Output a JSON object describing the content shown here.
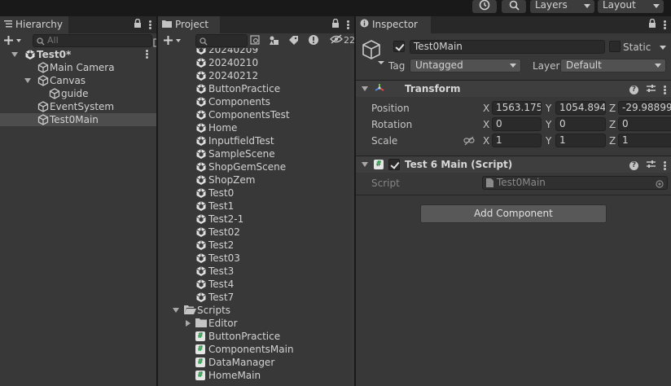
{
  "toolbar": {
    "history_icon": "history-icon",
    "search_icon": "search-icon",
    "layers_label": "Layers",
    "layout_label": "Layout"
  },
  "hierarchy": {
    "tab_label": "Hierarchy",
    "search_placeholder": "All",
    "items": [
      {
        "label": "Test0*",
        "level": 0,
        "expanded": true,
        "bold": true,
        "icon": "unity-scene-icon"
      },
      {
        "label": "Main Camera",
        "level": 1,
        "icon": "gameobject-cube-icon"
      },
      {
        "label": "Canvas",
        "level": 1,
        "expanded": true,
        "icon": "gameobject-cube-icon"
      },
      {
        "label": "guide",
        "level": 2,
        "icon": "gameobject-cube-icon"
      },
      {
        "label": "EventSystem",
        "level": 1,
        "icon": "gameobject-cube-icon"
      },
      {
        "label": "Test0Main",
        "level": 1,
        "selected": true,
        "icon": "gameobject-cube-icon"
      }
    ]
  },
  "project": {
    "tab_label": "Project",
    "hidden_count": "22",
    "items": [
      {
        "label": "20240209",
        "icon": "unity-scene-icon"
      },
      {
        "label": "20240210",
        "icon": "unity-scene-icon"
      },
      {
        "label": "20240212",
        "icon": "unity-scene-icon"
      },
      {
        "label": "ButtonPractice",
        "icon": "unity-scene-icon"
      },
      {
        "label": "Components",
        "icon": "unity-scene-icon"
      },
      {
        "label": "ComponentsTest",
        "icon": "unity-scene-icon"
      },
      {
        "label": "Home",
        "icon": "unity-scene-icon"
      },
      {
        "label": "InputfieldTest",
        "icon": "unity-scene-icon"
      },
      {
        "label": "SampleScene",
        "icon": "unity-scene-icon"
      },
      {
        "label": "ShopGemScene",
        "icon": "unity-scene-icon"
      },
      {
        "label": "ShopZem",
        "icon": "unity-scene-icon"
      },
      {
        "label": "Test0",
        "icon": "unity-scene-icon"
      },
      {
        "label": "Test1",
        "icon": "unity-scene-icon"
      },
      {
        "label": "Test2-1",
        "icon": "unity-scene-icon"
      },
      {
        "label": "Test02",
        "icon": "unity-scene-icon"
      },
      {
        "label": "Test2",
        "icon": "unity-scene-icon"
      },
      {
        "label": "Test03",
        "icon": "unity-scene-icon"
      },
      {
        "label": "Test3",
        "icon": "unity-scene-icon"
      },
      {
        "label": "Test4",
        "icon": "unity-scene-icon"
      },
      {
        "label": "Test7",
        "icon": "unity-scene-icon"
      },
      {
        "label": "Scripts",
        "icon": "folder-open-icon",
        "folder": true,
        "expanded": true
      },
      {
        "label": "Editor",
        "icon": "folder-icon",
        "folder": true,
        "collapsed": true
      },
      {
        "label": "ButtonPractice",
        "icon": "csharp-script-icon"
      },
      {
        "label": "ComponentsMain",
        "icon": "csharp-script-icon"
      },
      {
        "label": "DataManager",
        "icon": "csharp-script-icon"
      },
      {
        "label": "HomeMain",
        "icon": "csharp-script-icon"
      }
    ]
  },
  "inspector": {
    "tab_label": "Inspector",
    "object_name": "Test0Main",
    "active": true,
    "static_label": "Static",
    "tag_label": "Tag",
    "tag_value": "Untagged",
    "layer_label": "Layer",
    "layer_value": "Default",
    "transform": {
      "title": "Transform",
      "position_label": "Position",
      "rotation_label": "Rotation",
      "scale_label": "Scale",
      "x_label": "X",
      "y_label": "Y",
      "z_label": "Z",
      "position": {
        "x": "1563.175",
        "y": "1054.894",
        "z": "-29.98899"
      },
      "rotation": {
        "x": "0",
        "y": "0",
        "z": "0"
      },
      "scale": {
        "x": "1",
        "y": "1",
        "z": "1"
      }
    },
    "script_component": {
      "title": "Test 6 Main (Script)",
      "enabled": true,
      "script_label": "Script",
      "script_value": "Test0Main"
    },
    "add_component_label": "Add Component"
  }
}
